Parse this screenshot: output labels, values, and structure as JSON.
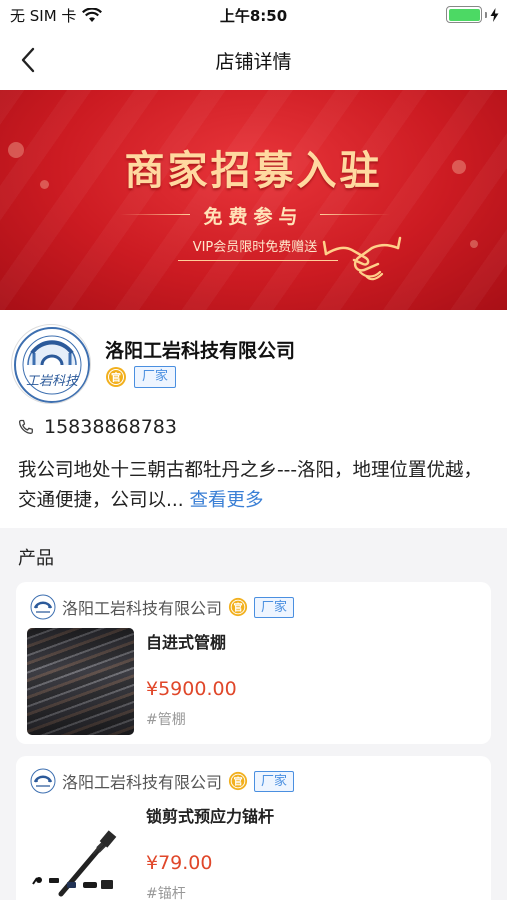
{
  "status_bar": {
    "carrier": "无 SIM 卡",
    "time": "上午8:50",
    "battery_level": 1.0,
    "battery_color": "#4cd964"
  },
  "nav": {
    "back_icon": "chevron-left-icon",
    "title": "店铺详情"
  },
  "banner": {
    "headline": "商家招募入驻",
    "subtitle": "免费参与",
    "tagline": "VIP会员限时免费赠送",
    "colors": {
      "background": "#cc1b22",
      "headline": "#ffd9a0"
    }
  },
  "shop": {
    "logo_text": "工岩科技",
    "name": "洛阳工岩科技有限公司",
    "official_badge": "官",
    "tag": "厂家",
    "phone": "15838868783",
    "description": "我公司地处十三朝古都牡丹之乡---洛阳，地理位置优越，交通便捷，公司以...",
    "more_link": "查看更多"
  },
  "products": {
    "title": "产品",
    "items": [
      {
        "shop_name": "洛阳工岩科技有限公司",
        "badge": "官",
        "tag": "厂家",
        "name": "自进式管棚",
        "price": "¥5900.00",
        "category": "#管棚"
      },
      {
        "shop_name": "洛阳工岩科技有限公司",
        "badge": "官",
        "tag": "厂家",
        "name": "锁剪式预应力锚杆",
        "price": "¥79.00",
        "category": "#锚杆"
      }
    ]
  },
  "colors": {
    "accent_link": "#3a7fd5",
    "price": "#e0472a",
    "tag_border": "#4a8fe0",
    "badge": "#f2b01e"
  }
}
